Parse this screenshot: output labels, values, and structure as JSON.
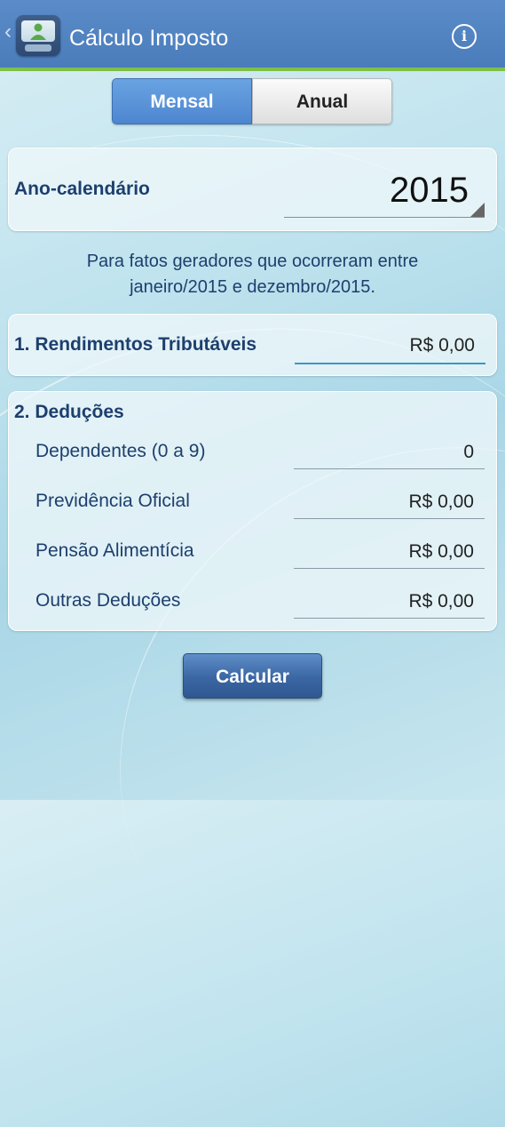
{
  "header": {
    "title": "Cálculo Imposto",
    "back_glyph": "‹",
    "info_glyph": "i",
    "colors": {
      "bar": "#4a7cbb",
      "accent_line": "#7ec049"
    }
  },
  "period_toggle": {
    "options": [
      "Mensal",
      "Anual"
    ],
    "selected": "Mensal"
  },
  "calendar_year": {
    "label": "Ano-calendário",
    "value": "2015"
  },
  "note": {
    "line1": "Para fatos geradores que ocorreram entre",
    "line2": "janeiro/2015 e dezembro/2015."
  },
  "taxable_income": {
    "label": "1. Rendimentos Tributáveis",
    "value": "R$ 0,00"
  },
  "deductions": {
    "heading": "2. Deduções",
    "items": [
      {
        "label": "Dependentes (0 a 9)",
        "value": "0"
      },
      {
        "label": "Previdência Oficial",
        "value": "R$ 0,00"
      },
      {
        "label": "Pensão Alimentícia",
        "value": "R$ 0,00"
      },
      {
        "label": "Outras Deduções",
        "value": "R$ 0,00"
      }
    ]
  },
  "calculate_button": {
    "label": "Calcular"
  }
}
